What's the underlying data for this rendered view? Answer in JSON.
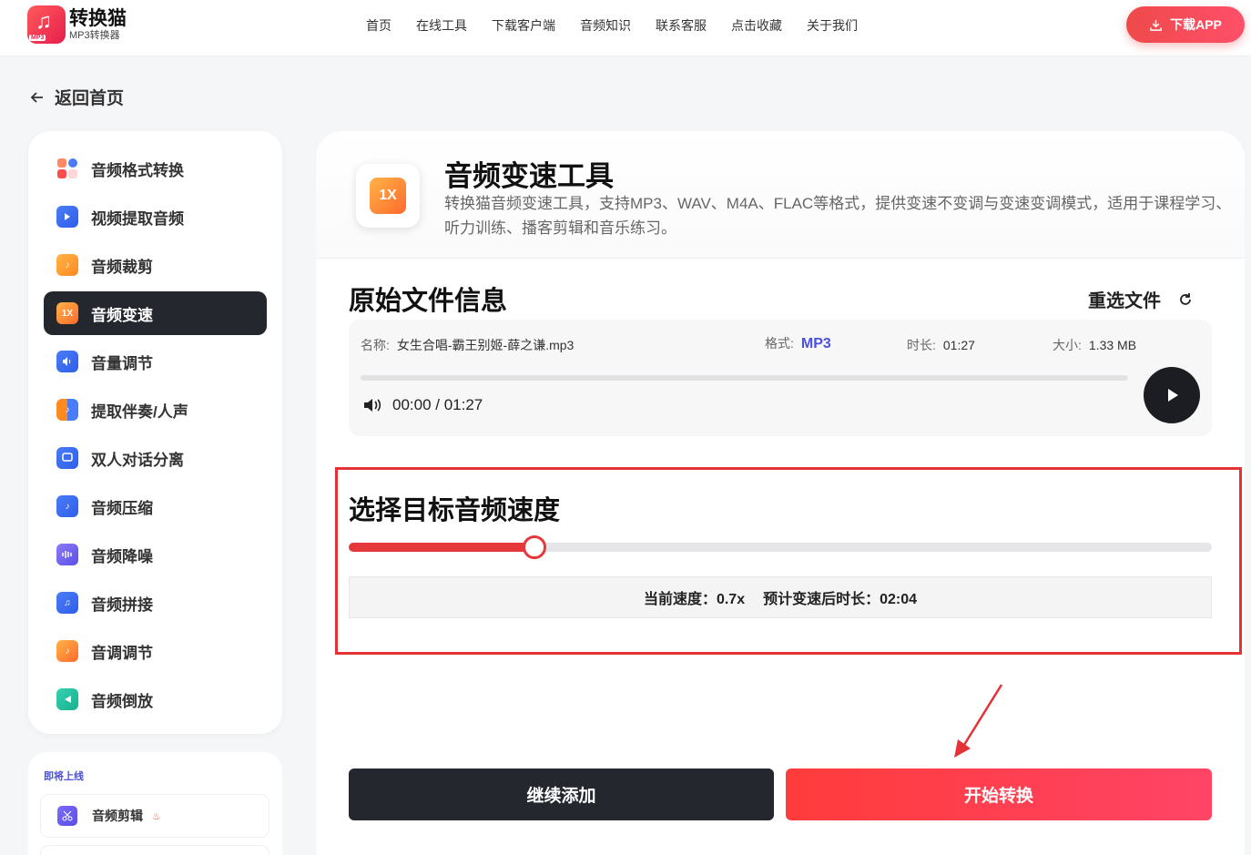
{
  "header": {
    "logo_title": "转换猫",
    "logo_sub": "MP3转换器",
    "logo_tag": "MP3",
    "nav": [
      "首页",
      "在线工具",
      "下载客户端",
      "音频知识",
      "联系客服",
      "点击收藏",
      "关于我们"
    ],
    "download_label": "下载APP",
    "brand_color": "#ee4a4a"
  },
  "back_label": "返回首页",
  "sidebar": {
    "items": [
      {
        "label": "音频格式转换",
        "icon": "format-convert-icon"
      },
      {
        "label": "视频提取音频",
        "icon": "video-extract-icon"
      },
      {
        "label": "音频裁剪",
        "icon": "audio-cut-icon"
      },
      {
        "label": "音频变速",
        "icon": "speed-icon",
        "icon_text": "1X",
        "active": true
      },
      {
        "label": "音量调节",
        "icon": "volume-icon"
      },
      {
        "label": "提取伴奏/人声",
        "icon": "vocal-extract-icon"
      },
      {
        "label": "双人对话分离",
        "icon": "dialog-split-icon"
      },
      {
        "label": "音频压缩",
        "icon": "compress-icon"
      },
      {
        "label": "音频降噪",
        "icon": "denoise-icon"
      },
      {
        "label": "音频拼接",
        "icon": "merge-icon"
      },
      {
        "label": "音调调节",
        "icon": "pitch-icon"
      },
      {
        "label": "音频倒放",
        "icon": "reverse-icon"
      }
    ],
    "soon_title": "即将上线",
    "soon_items": [
      {
        "label": "音频剪辑",
        "icon": "scissors-icon"
      }
    ]
  },
  "tool": {
    "icon_text": "1X",
    "title": "音频变速工具",
    "desc": "转换猫音频变速工具，支持MP3、WAV、M4A、FLAC等格式，提供变速不变调与变速变调模式，适用于课程学习、听力训练、播客剪辑和音乐练习。"
  },
  "file_info": {
    "section_title": "原始文件信息",
    "reselect_label": "重选文件",
    "name_key": "名称:",
    "name_val": "女生合唱-霸王别姬-薛之谦.mp3",
    "format_key": "格式:",
    "format_val": "MP3",
    "duration_key": "时长:",
    "duration_val": "01:27",
    "size_key": "大小:",
    "size_val": "1.33 MB",
    "time_display": "00:00 / 01:27",
    "progress": 0
  },
  "speed": {
    "section_title": "选择目标音频速度",
    "slider_fraction": 0.215,
    "current_label": "当前速度：0.7x",
    "estimate_label": "预计变速后时长：02:04"
  },
  "actions": {
    "continue_label": "继续添加",
    "start_label": "开始转换"
  }
}
